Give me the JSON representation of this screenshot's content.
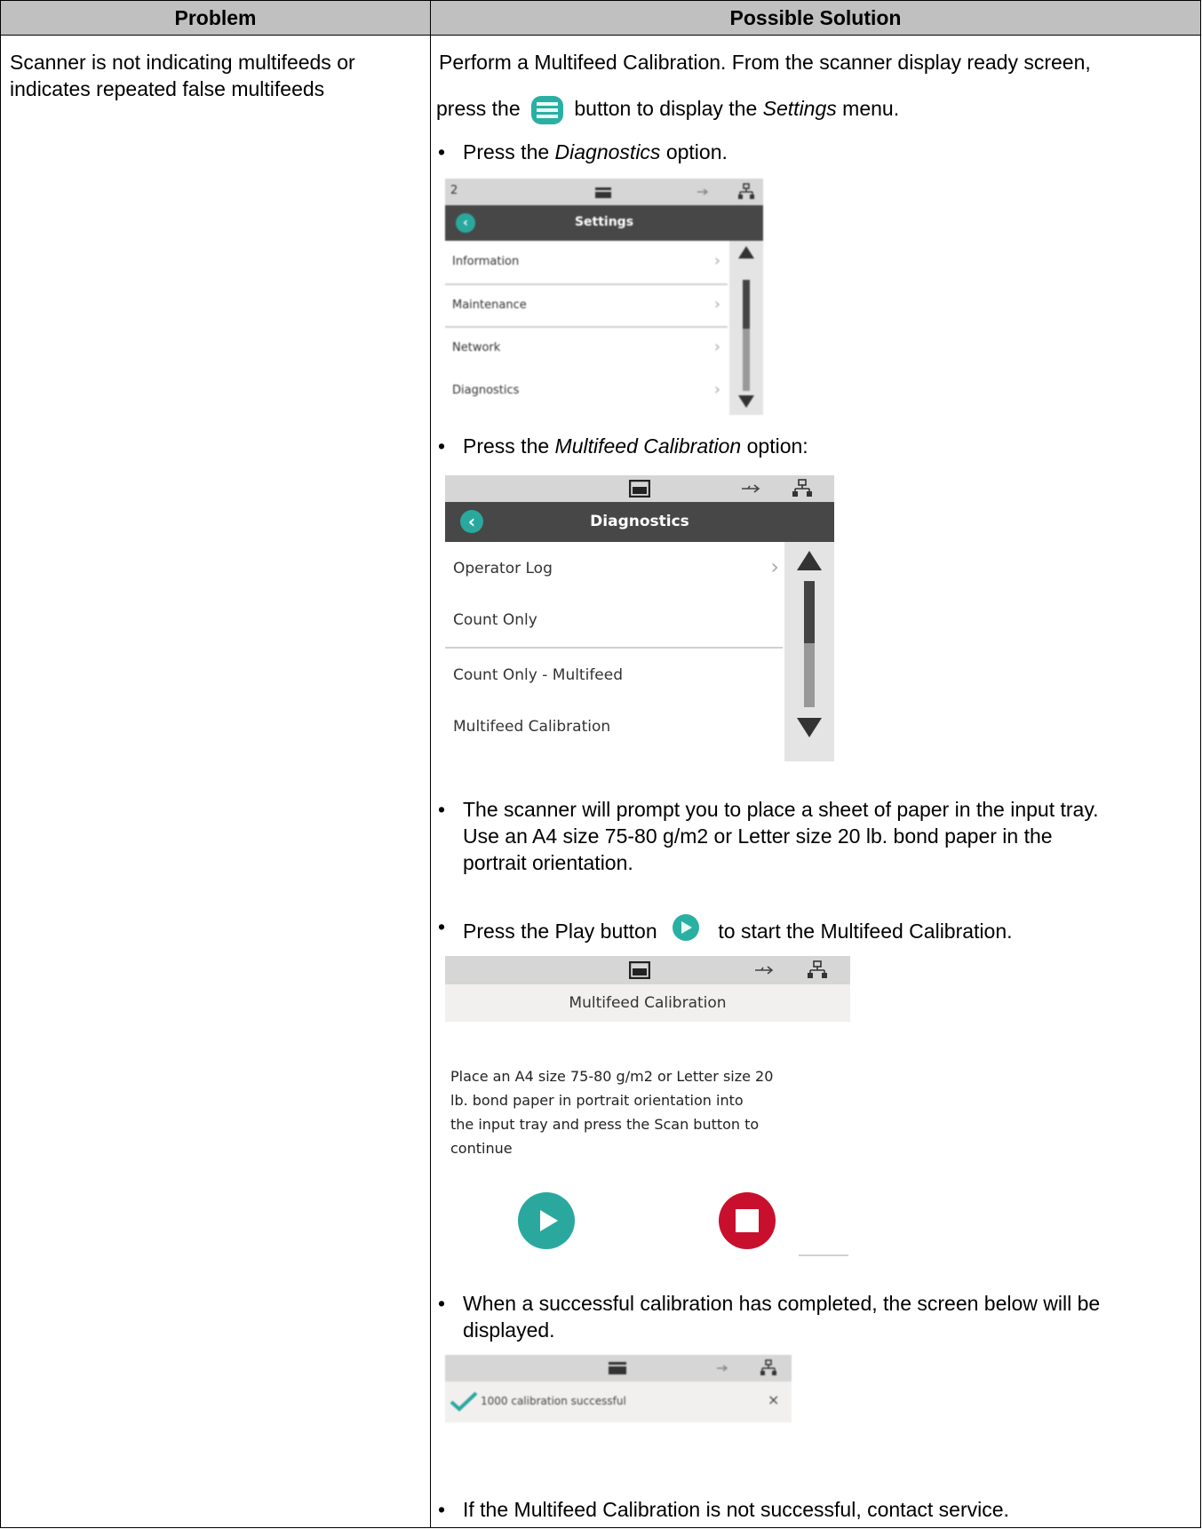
{
  "table": {
    "col_problem": "Problem",
    "col_solution": "Possible Solution",
    "problem_text_1": "Scanner is not indicating multifeeds or",
    "problem_text_2": "indicates repeated false multifeeds",
    "intro_1": "Perform a Multifeed Calibration. From the scanner display ready screen,",
    "intro_2_a": "press the",
    "intro_2_b": "button to display the",
    "intro_2_c": "Settings",
    "intro_2_d": "menu.",
    "step1_a": "Press the",
    "step1_b": "Diagnostics",
    "step1_c": "option.",
    "step2_a": "Press the",
    "step2_b": "Multifeed Calibration",
    "step2_c": "option:",
    "step3_1": "The scanner will prompt you to place a sheet of paper in the input tray.",
    "step3_2": "Use an A4 size 75-80 g/m2 or Letter size 20 lb. bond paper in the",
    "step3_3": "portrait orientation.",
    "step4_a": "Press the Play button",
    "step4_b": "to start the Multifeed Calibration.",
    "step5_1": "When a successful calibration has completed, the screen below will be",
    "step5_2": "displayed.",
    "step6": "If the Multifeed Calibration is not successful, contact service.",
    "bullet": "•"
  },
  "settings_screen": {
    "status_left": "2",
    "title": "Settings",
    "items": [
      "Information",
      "Maintenance",
      "Network",
      "Diagnostics"
    ]
  },
  "diagnostics_screen": {
    "title": "Diagnostics",
    "items": [
      "Operator Log",
      "Count Only",
      "Count Only - Multifeed",
      "Multifeed Calibration"
    ]
  },
  "calibration_screen": {
    "title": "Multifeed Calibration",
    "message_1": "Place an A4 size 75-80 g/m2 or Letter size 20",
    "message_2": "lb. bond paper in portrait orientation into",
    "message_3": "the input tray and press the Scan button to",
    "message_4": "continue"
  },
  "success_screen": {
    "message": "1000 calibration successful",
    "close": "×"
  },
  "icons": {
    "menu": "menu-icon",
    "play": "play-icon",
    "stop": "stop-icon",
    "usb": "usb-icon",
    "network": "network-icon",
    "tray": "tray-icon",
    "back": "back-arrow-icon",
    "check": "check-icon",
    "chevron": "chevron-right-icon"
  },
  "colors": {
    "header_bg": "#c0c0c0",
    "teal": "#2aa89e",
    "stop_red": "#c8102e",
    "title_bar": "#474747"
  }
}
